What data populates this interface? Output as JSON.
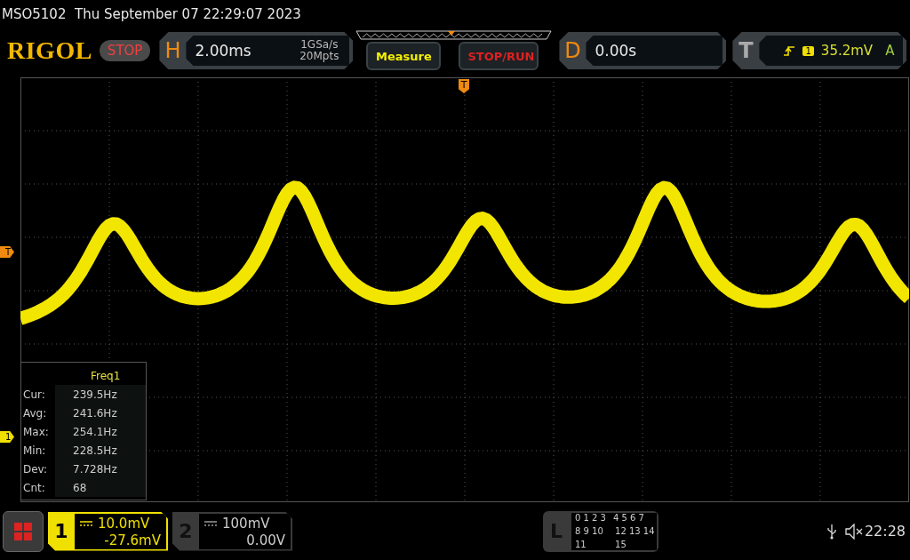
{
  "header": {
    "model": "MSO5102",
    "datetime": "Thu September 07 22:29:07 2023"
  },
  "top_bar": {
    "logo": "RIGOL",
    "run_state": "STOP",
    "horizontal": {
      "label": "H",
      "timebase": "2.00ms",
      "sample_rate": "1GSa/s",
      "memory_depth": "20Mpts"
    },
    "buttons": [
      "Measure",
      "STOP/RUN"
    ],
    "delay": {
      "label": "D",
      "value": "0.00s"
    },
    "trigger": {
      "label": "T",
      "source": "1",
      "level": "35.2mV",
      "mode": "A"
    }
  },
  "markers": {
    "trigger_position": "T",
    "trigger_level": "T",
    "channel_1": "1"
  },
  "measurement": {
    "title": "Freq1",
    "rows": [
      {
        "label": "Cur:",
        "value": "239.5Hz"
      },
      {
        "label": "Avg:",
        "value": "241.6Hz"
      },
      {
        "label": "Max:",
        "value": "254.1Hz"
      },
      {
        "label": "Min:",
        "value": "228.5Hz"
      },
      {
        "label": "Dev:",
        "value": "7.728Hz"
      },
      {
        "label": "Cnt:",
        "value": "68"
      }
    ]
  },
  "channels": [
    {
      "number": "1",
      "scale": "10.0mV",
      "offset": "-27.6mV",
      "selected": true
    },
    {
      "number": "2",
      "scale": "100mV",
      "offset": "0.00V",
      "selected": false
    }
  ],
  "logic": {
    "label": "L",
    "rows": [
      [
        "0 1 2 3",
        "4 5 6 7"
      ],
      [
        "8 9 10 11",
        "12 13 14 15"
      ]
    ]
  },
  "status": {
    "time": "22:28"
  }
}
